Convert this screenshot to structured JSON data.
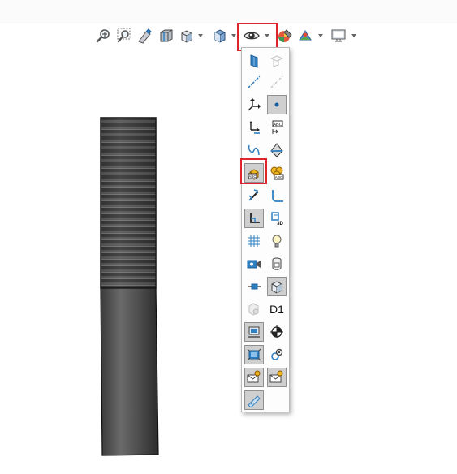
{
  "toolbar": {
    "buttons": [
      {
        "icon": "zoom-to-fit-icon"
      },
      {
        "icon": "zoom-to-area-icon"
      },
      {
        "icon": "previous-view-icon"
      },
      {
        "icon": "section-view-icon"
      },
      {
        "icon": "view-orientation-icon"
      },
      {
        "icon": "display-style-icon"
      },
      {
        "icon": "hide-show-items-icon"
      },
      {
        "icon": "edit-appearance-icon"
      },
      {
        "icon": "apply-scene-icon"
      },
      {
        "icon": "view-settings-icon"
      }
    ]
  },
  "dropdown": {
    "items": [
      {
        "icon": "view-planes-icon",
        "state": "off"
      },
      {
        "icon": "view-sketch-planes-icon",
        "state": "disabled"
      },
      {
        "icon": "view-axes-icon",
        "state": "off"
      },
      {
        "icon": "view-temporary-axes-icon",
        "state": "disabled"
      },
      {
        "icon": "view-origins-icon",
        "state": "off"
      },
      {
        "icon": "view-points-icon",
        "state": "on"
      },
      {
        "icon": "view-coordinate-systems-icon",
        "state": "off"
      },
      {
        "icon": "view-dimension-names-icon",
        "state": "off"
      },
      {
        "icon": "view-curves-icon",
        "state": "off"
      },
      {
        "icon": "view-parting-lines-icon",
        "state": "off"
      },
      {
        "icon": "view-annotation-link-variables-icon",
        "state": "on-highlighted"
      },
      {
        "icon": "view-all-annotations-icon",
        "state": "off"
      },
      {
        "icon": "view-sketch-relations-icon",
        "state": "off"
      },
      {
        "icon": "view-routing-icon",
        "state": "off"
      },
      {
        "icon": "view-sketches-icon",
        "state": "on"
      },
      {
        "icon": "view-3d-sketch-planes-icon",
        "state": "off"
      },
      {
        "icon": "view-grid-icon",
        "state": "off"
      },
      {
        "icon": "view-lights-icon",
        "state": "off"
      },
      {
        "icon": "view-cameras-icon",
        "state": "off"
      },
      {
        "icon": "view-decals-icon",
        "state": "off"
      },
      {
        "icon": "view-weld-beads-icon",
        "state": "off"
      },
      {
        "icon": "view-bodies-icon",
        "state": "on"
      },
      {
        "icon": "view-center-of-mass-icon",
        "state": "disabled"
      },
      {
        "icon": "view-primary-dimensions-icon",
        "state": "off",
        "text": "D1"
      },
      {
        "icon": "view-live-section-planes-icon",
        "state": "on"
      },
      {
        "icon": "view-center-of-mass-symbol-icon",
        "state": "off"
      },
      {
        "icon": "view-sensors-icon",
        "state": "on"
      },
      {
        "icon": "view-routing-points-icon",
        "state": "off"
      },
      {
        "icon": "view-mail-notes-icon",
        "state": "on"
      },
      {
        "icon": "view-mail-notes-2-icon",
        "state": "on"
      },
      {
        "icon": "view-sketch-grid-icon",
        "state": "on"
      }
    ]
  },
  "colors": {
    "highlight": "#e0242b",
    "accent_blue": "#2f7fc1",
    "model_dark": "#2e2e2e"
  }
}
